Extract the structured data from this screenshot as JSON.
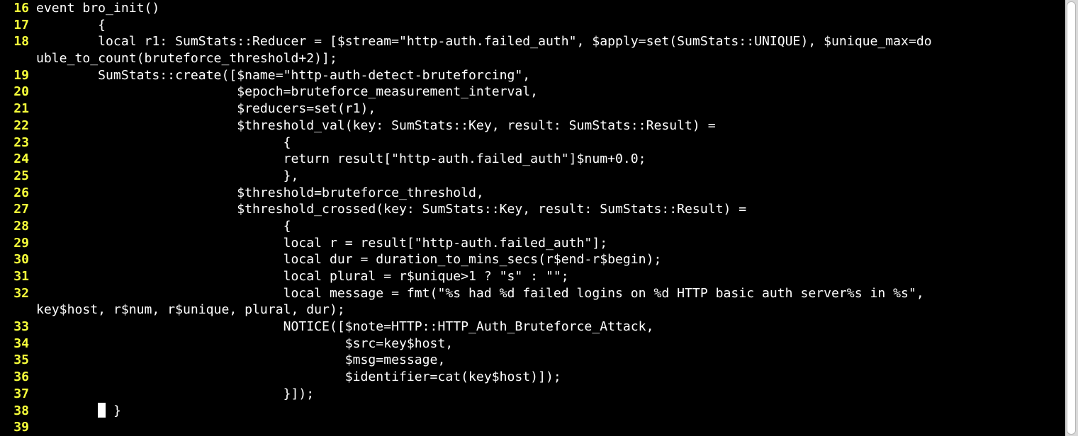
{
  "editor": {
    "lines": [
      {
        "num": "16",
        "text": "event bro_init()"
      },
      {
        "num": "17",
        "text": "        {"
      },
      {
        "num": "18",
        "text": "        local r1: SumStats::Reducer = [$stream=\"http-auth.failed_auth\", $apply=set(SumStats::UNIQUE), $unique_max=do"
      },
      {
        "num": "",
        "text": "uble_to_count(bruteforce_threshold+2)];"
      },
      {
        "num": "19",
        "text": "        SumStats::create([$name=\"http-auth-detect-bruteforcing\","
      },
      {
        "num": "20",
        "text": "                          $epoch=bruteforce_measurement_interval,"
      },
      {
        "num": "21",
        "text": "                          $reducers=set(r1),"
      },
      {
        "num": "22",
        "text": "                          $threshold_val(key: SumStats::Key, result: SumStats::Result) ="
      },
      {
        "num": "23",
        "text": "                                {"
      },
      {
        "num": "24",
        "text": "                                return result[\"http-auth.failed_auth\"]$num+0.0;"
      },
      {
        "num": "25",
        "text": "                                },"
      },
      {
        "num": "26",
        "text": "                          $threshold=bruteforce_threshold,"
      },
      {
        "num": "27",
        "text": "                          $threshold_crossed(key: SumStats::Key, result: SumStats::Result) ="
      },
      {
        "num": "28",
        "text": "                                {"
      },
      {
        "num": "29",
        "text": "                                local r = result[\"http-auth.failed_auth\"];"
      },
      {
        "num": "30",
        "text": "                                local dur = duration_to_mins_secs(r$end-r$begin);"
      },
      {
        "num": "31",
        "text": "                                local plural = r$unique>1 ? \"s\" : \"\";"
      },
      {
        "num": "32",
        "text": "                                local message = fmt(\"%s had %d failed logins on %d HTTP basic auth server%s in %s\","
      },
      {
        "num": "",
        "text": "key$host, r$num, r$unique, plural, dur);"
      },
      {
        "num": "33",
        "text": "                                NOTICE([$note=HTTP::HTTP_Auth_Bruteforce_Attack,"
      },
      {
        "num": "34",
        "text": "                                        $src=key$host,"
      },
      {
        "num": "35",
        "text": "                                        $msg=message,"
      },
      {
        "num": "36",
        "text": "                                        $identifier=cat(key$host)]);"
      },
      {
        "num": "37",
        "text": "                                }]);"
      },
      {
        "num": "38",
        "text_before_cursor": "        ",
        "text": " }"
      },
      {
        "num": "39",
        "text": ""
      }
    ]
  }
}
